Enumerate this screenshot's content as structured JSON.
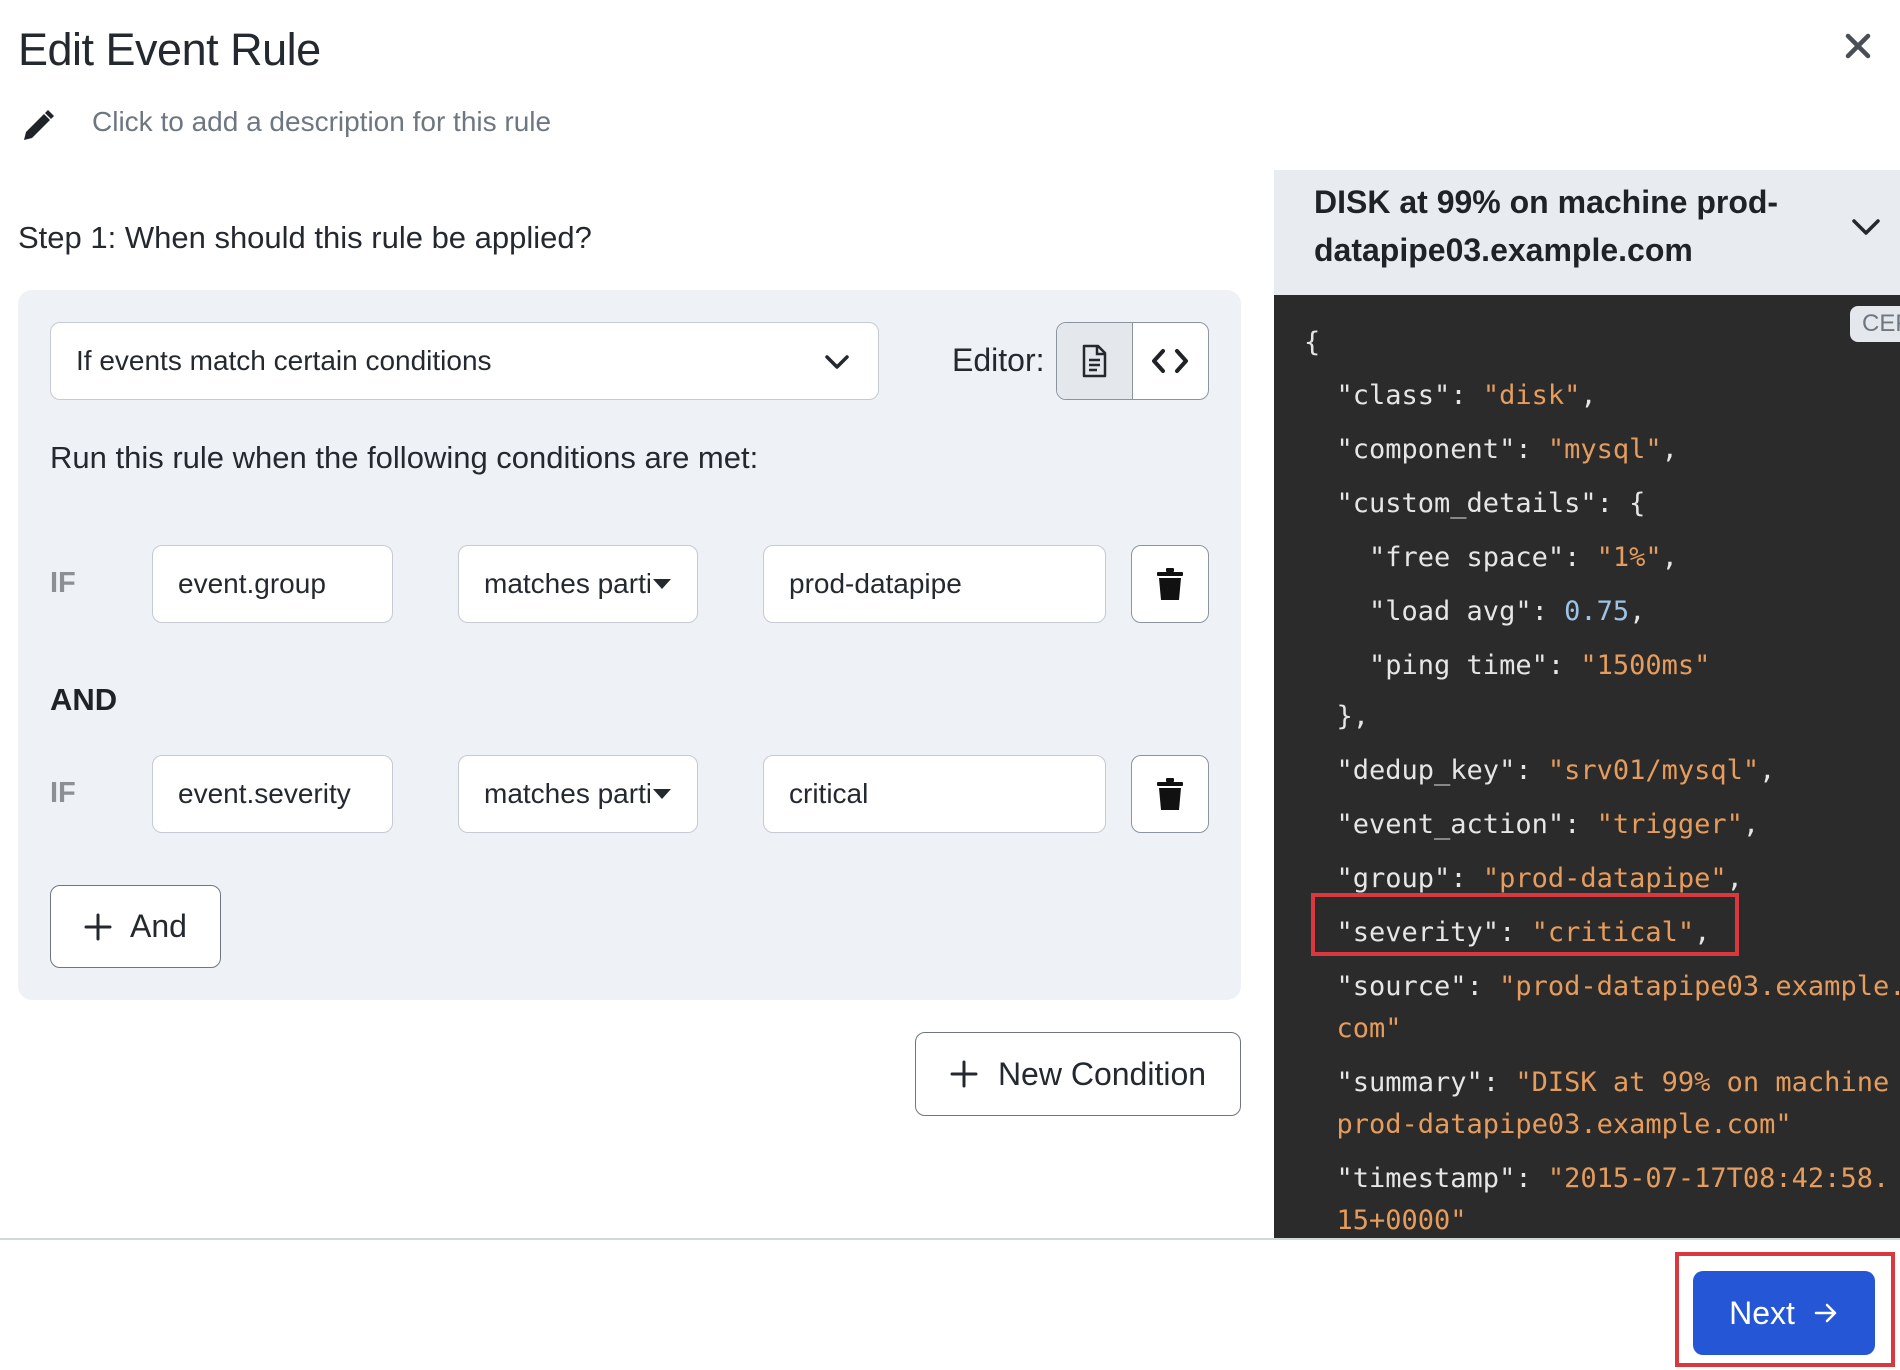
{
  "dialog": {
    "title": "Edit Event Rule",
    "description_placeholder": "Click to add a description for this rule",
    "close_icon": "close-icon",
    "edit_icon": "pencil-icon"
  },
  "step1": {
    "heading": "Step 1: When should this rule be applied?",
    "mode_select": "If events match certain conditions",
    "editor_label": "Editor:",
    "editor_modes": [
      {
        "icon": "document-icon",
        "active": true
      },
      {
        "icon": "code-icon",
        "active": false
      }
    ],
    "run_text": "Run this rule when the following conditions are met:",
    "conditions": [
      {
        "prefix": "IF",
        "field": "event.group",
        "operator": "matches partially",
        "value": "prod-datapipe"
      },
      {
        "prefix": "IF",
        "field": "event.severity",
        "operator": "matches partially",
        "value": "critical"
      }
    ],
    "joiner": "AND",
    "and_button": "And",
    "new_condition_button": "New Condition"
  },
  "event_preview": {
    "title": "DISK at 99% on machine prod-datapipe03.example.com",
    "badge": "CEF",
    "json_lines": [
      [
        [
          "p",
          "{"
        ]
      ],
      [
        [
          "k",
          "  \"class\""
        ],
        [
          "p",
          ": "
        ],
        [
          "s",
          "\"disk\""
        ],
        [
          "p",
          ","
        ]
      ],
      [
        [
          "k",
          "  \"component\""
        ],
        [
          "p",
          ": "
        ],
        [
          "s",
          "\"mysql\""
        ],
        [
          "p",
          ","
        ]
      ],
      [
        [
          "k",
          "  \"custom_details\""
        ],
        [
          "p",
          ": {"
        ]
      ],
      [
        [
          "k",
          "    \"free space\""
        ],
        [
          "p",
          ": "
        ],
        [
          "s",
          "\"1%\""
        ],
        [
          "p",
          ","
        ]
      ],
      [
        [
          "k",
          "    \"load avg\""
        ],
        [
          "p",
          ": "
        ],
        [
          "n",
          "0.75"
        ],
        [
          "p",
          ","
        ]
      ],
      [
        [
          "k",
          "    \"ping time\""
        ],
        [
          "p",
          ": "
        ],
        [
          "s",
          "\"1500ms\""
        ]
      ],
      [
        [
          "p",
          "  },"
        ]
      ],
      [
        [
          "k",
          "  \"dedup_key\""
        ],
        [
          "p",
          ": "
        ],
        [
          "s",
          "\"srv01/mysql\""
        ],
        [
          "p",
          ","
        ]
      ],
      [
        [
          "k",
          "  \"event_action\""
        ],
        [
          "p",
          ": "
        ],
        [
          "s",
          "\"trigger\""
        ],
        [
          "p",
          ","
        ]
      ],
      [
        [
          "k",
          "  \"group\""
        ],
        [
          "p",
          ": "
        ],
        [
          "s",
          "\"prod-datapipe\""
        ],
        [
          "p",
          ","
        ]
      ],
      [
        [
          "k",
          "  \"severity\""
        ],
        [
          "p",
          ": "
        ],
        [
          "s",
          "\"critical\""
        ],
        [
          "p",
          ","
        ]
      ],
      [
        [
          "k",
          "  \"source\""
        ],
        [
          "p",
          ": "
        ],
        [
          "s",
          "\"prod-datapipe03.example."
        ]
      ],
      [
        [
          "s",
          "  com\""
        ]
      ],
      [
        [
          "k",
          "  \"summary\""
        ],
        [
          "p",
          ": "
        ],
        [
          "s",
          "\"DISK at 99% on machine"
        ]
      ],
      [
        [
          "s",
          "  prod-datapipe03.example.com\""
        ]
      ],
      [
        [
          "k",
          "  \"timestamp\""
        ],
        [
          "p",
          ": "
        ],
        [
          "s",
          "\"2015-07-17T08:42:58."
        ]
      ],
      [
        [
          "s",
          "  15+0000\""
        ]
      ]
    ]
  },
  "footer": {
    "next_button": "Next"
  },
  "colors": {
    "primary": "#2556d6",
    "highlight": "#d9383f",
    "code_bg": "#2b2b2b",
    "json_string": "#e59c5c",
    "json_number": "#9ec3e6"
  }
}
